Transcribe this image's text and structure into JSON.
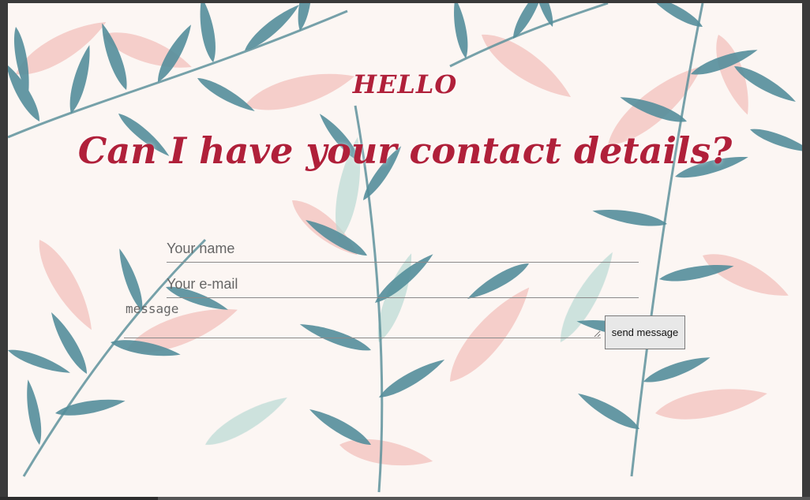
{
  "header": {
    "greeting": "HELLO",
    "title": "Can I have your contact details?"
  },
  "form": {
    "name_placeholder": "Your name",
    "email_placeholder": "Your e-mail",
    "message_placeholder": "message",
    "submit_label": "send message"
  },
  "colors": {
    "heading": "#b0203a",
    "leaf_teal": "#2f7585",
    "leaf_pink": "#f1b7b0"
  }
}
